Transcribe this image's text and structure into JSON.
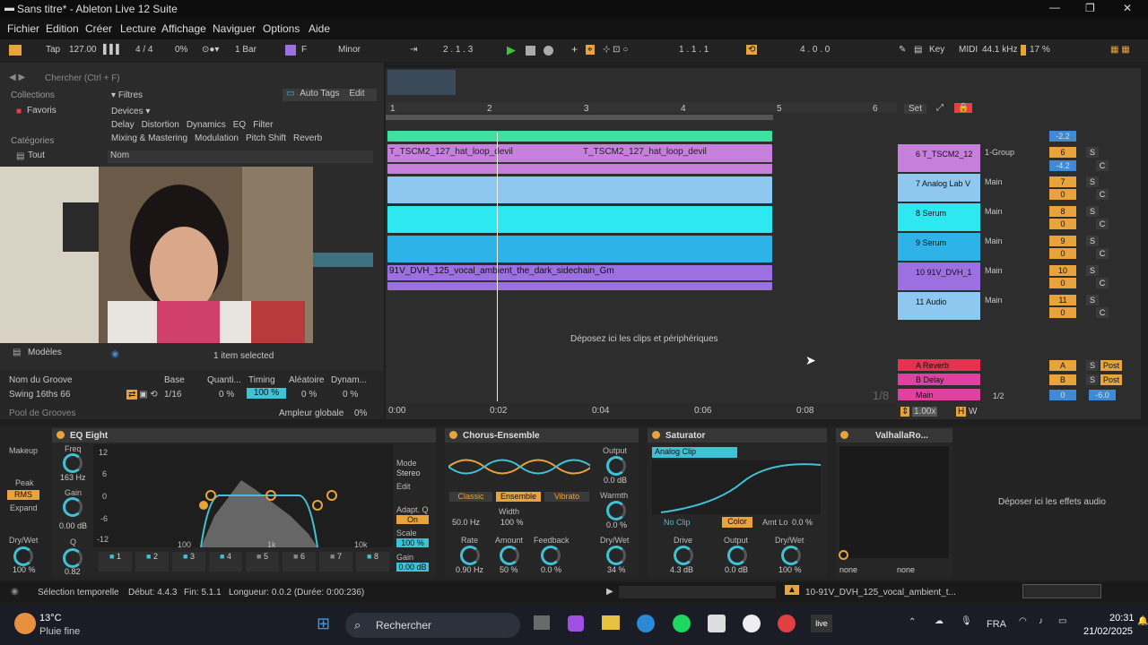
{
  "window": {
    "title": "Sans titre* - Ableton Live 12 Suite",
    "min": "—",
    "max": "❐",
    "close": "✕"
  },
  "menu": [
    "Fichier",
    "Edition",
    "Créer",
    "Lecture",
    "Affichage",
    "Naviguer",
    "Options",
    "Aide"
  ],
  "transport": {
    "tap": "Tap",
    "tempo": "127.00",
    "sig": "4 / 4",
    "swing": "0%",
    "quant": "1 Bar",
    "key": "F",
    "scale": "Minor",
    "pos": "2 . 1 . 3",
    "loop_start": "1 . 1 . 1",
    "loop_len": "4 . 0 . 0",
    "keylbl": "Key",
    "midilbl": "MIDI",
    "sr": "44.1 kHz",
    "cpu": "17 %"
  },
  "browser": {
    "search": "Chercher (Ctrl + F)",
    "collections": "Collections",
    "favoris": "Favoris",
    "categories": "Catégories",
    "tout": "Tout",
    "filtres": "Filtres",
    "autotags": "Auto Tags",
    "edit": "Edit",
    "devices": "Devices",
    "tags1": [
      "Delay",
      "Distortion",
      "Dynamics",
      "EQ",
      "Filter"
    ],
    "tags2": [
      "Mixing & Mastering",
      "Modulation",
      "Pitch Shift",
      "Reverb"
    ],
    "nom": "Nom",
    "modeles": "Modèles",
    "selected": "1 item selected"
  },
  "groove": {
    "headers": [
      "Nom du Groove",
      "Base",
      "Quanti...",
      "Timing",
      "Aléatoire",
      "Dynam..."
    ],
    "name": "Swing 16ths 66",
    "base": "1/16",
    "quant": "0 %",
    "timing": "100 %",
    "random": "0 %",
    "dyn": "0 %",
    "pool": "Pool de Grooves",
    "amp_label": "Ampleur globale",
    "amp": "0%"
  },
  "arrangement": {
    "bars": [
      "1",
      "2",
      "3",
      "4",
      "5",
      "6"
    ],
    "clip1": "T_TSCM2_127_hat_loop_devil",
    "clip2": "T_TSCM2_127_hat_loop_devil",
    "clip3": "91V_DVH_125_vocal_ambient_the_dark_sidechain_Gm",
    "drop": "Déposez ici les clips et périphériques",
    "times": [
      "0:00",
      "0:02",
      "0:04",
      "0:06",
      "0:08"
    ],
    "set": "Set",
    "zoom": "1/8",
    "pct": "1.00x",
    "h": "H",
    "w": "W"
  },
  "tracks": [
    {
      "name": "6 T_TSCM2_12",
      "route": "1-Group",
      "num": "6",
      "vol": "-4.2",
      "pan": "C",
      "color": "#c77fdc"
    },
    {
      "name": "7 Analog Lab V",
      "route": "Main",
      "num": "7",
      "vol": "0",
      "pan": "C",
      "color": "#8ec8f0"
    },
    {
      "name": "8 Serum",
      "route": "Main",
      "num": "8",
      "vol": "0",
      "pan": "C",
      "color": "#2de8f0"
    },
    {
      "name": "9 Serum",
      "route": "Main",
      "num": "9",
      "vol": "0",
      "pan": "C",
      "color": "#2db3e8"
    },
    {
      "name": "10 91V_DVH_1",
      "route": "Main",
      "num": "10",
      "vol": "0",
      "pan": "C",
      "color": "#9c70e0"
    },
    {
      "name": "11 Audio",
      "route": "Main",
      "num": "11",
      "vol": "0",
      "pan": "C",
      "color": "#8ec8f0"
    }
  ],
  "returns": [
    {
      "name": "A Reverb",
      "num": "A",
      "post": "Post"
    },
    {
      "name": "B Delay",
      "num": "B",
      "post": "Post"
    },
    {
      "name": "Main",
      "num": "1/2",
      "vol": "0",
      "pan": "-6.0"
    }
  ],
  "top_vol": "-2.2",
  "devices": {
    "comp": {
      "makeup": "Makeup",
      "peak": "Peak",
      "rms": "RMS",
      "expand": "Expand",
      "drywet": "Dry/Wet",
      "dw": "100 %"
    },
    "eq": {
      "title": "EQ Eight",
      "freq": "Freq",
      "freqv": "163 Hz",
      "gain": "Gain",
      "gainv": "0.00 dB",
      "q": "Q",
      "qv": "0.82",
      "ylabels": [
        "12",
        "6",
        "0",
        "-6",
        "-12"
      ],
      "xlabels": [
        "100",
        "1k",
        "10k"
      ],
      "mode": "Mode",
      "stereo": "Stereo",
      "edit": "Edit",
      "adapt": "Adapt. Q",
      "on": "On",
      "scale": "Scale",
      "scalev": "100 %",
      "gainlbl": "Gain",
      "gainout": "0.00 dB",
      "bands": [
        "1",
        "2",
        "3",
        "4",
        "5",
        "6",
        "7",
        "8"
      ]
    },
    "chorus": {
      "title": "Chorus-Ensemble",
      "classic": "Classic",
      "ensemble": "Ensemble",
      "vibrato": "Vibrato",
      "hz": "50.0 Hz",
      "width": "Width",
      "widthv": "100 %",
      "output": "Output",
      "outputv": "0.0 dB",
      "warmth": "Warmth",
      "warmthv": "0.0 %",
      "rate": "Rate",
      "ratev": "0.90 Hz",
      "amount": "Amount",
      "amountv": "50 %",
      "feedback": "Feedback",
      "feedbackv": "0.0 %",
      "drywet": "Dry/Wet",
      "dwv": "34 %"
    },
    "sat": {
      "title": "Saturator",
      "type": "Analog Clip",
      "noclip": "No Clip",
      "color": "Color",
      "amt": "Amt Lo",
      "amtv": "0.0 %",
      "drive": "Drive",
      "drivev": "4.3 dB",
      "output": "Output",
      "outputv": "0.0 dB",
      "drywet": "Dry/Wet",
      "dwv": "100 %"
    },
    "valhalla": {
      "title": "ValhallaRo...",
      "none1": "none",
      "none2": "none"
    },
    "drop": "Déposer ici les effets audio"
  },
  "status": {
    "sel": "Sélection temporelle",
    "debut": "Début: 4.4.3",
    "fin": "Fin: 5.1.1",
    "long": "Longueur: 0.0.2 (Durée: 0:00:236)",
    "clipname": "10-91V_DVH_125_vocal_ambient_t..."
  },
  "taskbar": {
    "temp": "13°C",
    "weather": "Pluie fine",
    "search": "Rechercher",
    "lang": "FRA",
    "time": "20:31",
    "date": "21/02/2025"
  }
}
